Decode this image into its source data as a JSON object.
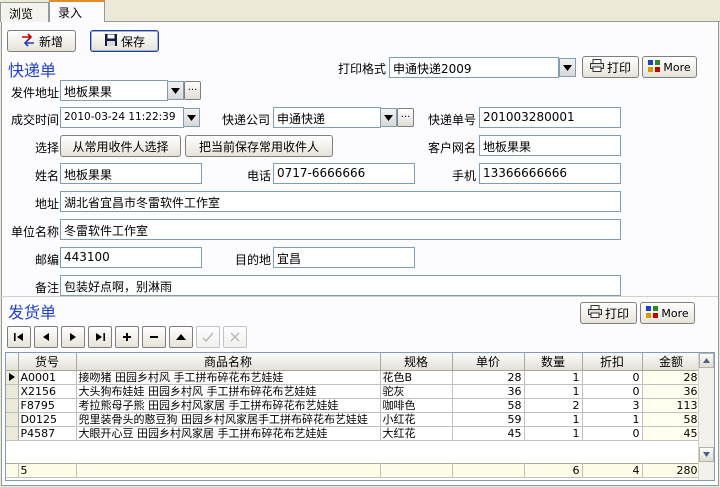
{
  "tabs": [
    {
      "label": "浏览"
    },
    {
      "label": "录入"
    }
  ],
  "toolbar": {
    "new_label": "新增",
    "save_label": "保存"
  },
  "express": {
    "title": "快递单",
    "print_format_label": "打印格式",
    "print_format_value": "申通快递2009",
    "print_label": "打印",
    "more_label": "More",
    "sender_address_label": "发件地址",
    "sender_address_value": "地板果果",
    "deal_time_label": "成交时间",
    "deal_time_value": "2010-03-24 11:22:39",
    "courier_label": "快递公司",
    "courier_value": "申通快递",
    "tracking_label": "快递单号",
    "tracking_value": "201003280001",
    "select_label": "选择",
    "select_contact_button": "从常用收件人选择",
    "save_contact_button": "把当前保存常用收件人",
    "customer_name_label": "客户网名",
    "customer_name_value": "地板果果",
    "name_label": "姓名",
    "name_value": "地板果果",
    "phone_label": "电话",
    "phone_value": "0717-6666666",
    "mobile_label": "手机",
    "mobile_value": "13366666666",
    "address_label": "地址",
    "address_value": "湖北省宜昌市冬雷软件工作室",
    "company_label": "单位名称",
    "company_value": "冬雷软件工作室",
    "zip_label": "邮编",
    "zip_value": "443100",
    "destination_label": "目的地",
    "destination_value": "宜昌",
    "remark_label": "备注",
    "remark_value": "包装好点啊，别淋雨"
  },
  "shipment": {
    "title": "发货单",
    "print_label": "打印",
    "more_label": "More",
    "columns": [
      "货号",
      "商品名称",
      "规格",
      "单价",
      "数量",
      "折扣",
      "金额"
    ],
    "rows": [
      {
        "code": "A0001",
        "name": "接吻猪 田园乡村风 手工拼布碎花布艺娃娃",
        "spec": "花色B",
        "price": "28",
        "qty": "1",
        "discount": "0",
        "amount": "28"
      },
      {
        "code": "X2156",
        "name": "大头狗布娃娃 田园乡村风 手工拼布碎花布艺娃娃",
        "spec": "驼灰",
        "price": "36",
        "qty": "1",
        "discount": "0",
        "amount": "36"
      },
      {
        "code": "F8795",
        "name": "考拉熊母子熊 田园乡村风家居 手工拼布碎花布艺娃娃",
        "spec": "咖啡色",
        "price": "58",
        "qty": "2",
        "discount": "3",
        "amount": "113"
      },
      {
        "code": "D0125",
        "name": "兜里装骨头的憨豆狗 田园乡村风家居手工拼布碎花布艺娃娃",
        "spec": "小红花",
        "price": "59",
        "qty": "1",
        "discount": "1",
        "amount": "58"
      },
      {
        "code": "P4587",
        "name": "大眼开心豆 田园乡村风家居 手工拼布碎花布艺娃娃",
        "spec": "大红花",
        "price": "45",
        "qty": "1",
        "discount": "0",
        "amount": "45"
      }
    ],
    "footer": {
      "count": "5",
      "qty": "6",
      "discount": "4",
      "amount": "280"
    }
  },
  "colors": {
    "title_blue": "#1f3fd0",
    "tab_accent": "#e68b2c",
    "panel_bg": "#fcfcfe",
    "window_bg": "#ece9d8"
  }
}
